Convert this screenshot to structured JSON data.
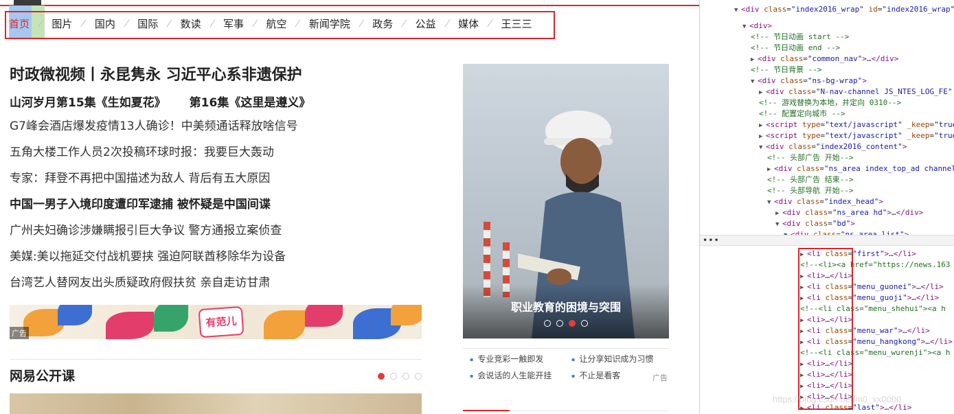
{
  "nav": {
    "items": [
      "首页",
      "图片",
      "国内",
      "国际",
      "数读",
      "军事",
      "航空",
      "新闻学院",
      "政务",
      "公益",
      "媒体",
      "王三三"
    ]
  },
  "content": {
    "headline": "时政微视频丨永昆隽永 习近平心系非遗保护",
    "subheads": [
      "山河岁月第15集《生如夏花》",
      "第16集《这里是遵义》"
    ],
    "news": [
      {
        "text": "G7峰会酒店爆发疫情13人确诊！中美频通话释放啥信号",
        "bold": false
      },
      {
        "text": "五角大楼工作人员2次投稿环球时报：我要巨大轰动",
        "bold": false
      },
      {
        "text": "专家：拜登不再把中国描述为敌人 背后有五大原因",
        "bold": false
      },
      {
        "text": "中国一男子入境印度遭印军逮捕 被怀疑是中国间谍",
        "bold": true
      },
      {
        "text": "广州夫妇确诊涉嫌瞒报引巨大争议 警方通报立案侦查",
        "bold": false
      },
      {
        "text": "美媒:美以拖延交付战机要挟 强迫阿联酋移除华为设备",
        "bold": false
      },
      {
        "text": "台湾艺人替网友出头质疑政府假扶贫 亲自走访甘肃",
        "bold": false
      }
    ],
    "ad_label": "广告",
    "ad_logo_text": "有范儿",
    "section_title": "网易公开课",
    "slide_title": "职业教育的困境与突围",
    "links": [
      "专业竞彩一触即发",
      "让分享知识成为习惯",
      "会说话的人生能开挂",
      "不止是看客"
    ],
    "links_ad": "广告"
  },
  "devtools": {
    "more": "•••",
    "watermark": "https://blog.csdn.net/m0_xx0000",
    "lines": [
      {
        "indent": 0,
        "html": "<span class='tri'>▼</span><span class='tag'>&lt;div</span> <span class='attr'>class</span>=<span class='val'>\"index2016_wrap\"</span> <span class='attr'>id</span>=<span class='val'>\"index2016_wrap\"</span><span class='tag'>&gt;</span>"
      },
      {
        "indent": 1,
        "html": "<span class='tri'>▼</span><span class='tag'>&lt;div&gt;</span>"
      },
      {
        "indent": 2,
        "html": "<span class='cmt'>&lt;!-- 节日动画 start --&gt;</span>"
      },
      {
        "indent": 2,
        "html": "<span class='cmt'>&lt;!-- 节日动画 end --&gt;</span>"
      },
      {
        "indent": 2,
        "html": "<span class='tri'>▶</span><span class='tag'>&lt;div</span> <span class='attr'>class</span>=<span class='val'>\"common_nav\"</span><span class='tag'>&gt;</span>…<span class='tag'>&lt;/div&gt;</span>"
      },
      {
        "indent": 2,
        "html": "<span class='cmt'>&lt;!-- 节日背景 --&gt;</span>"
      },
      {
        "indent": 2,
        "html": "<span class='tri'>▼</span><span class='tag'>&lt;div</span> <span class='attr'>class</span>=<span class='val'>\"ns-bg-wrap\"</span><span class='tag'>&gt;</span>"
      },
      {
        "indent": 3,
        "html": "<span class='tri'>▶</span><span class='tag'>&lt;div</span> <span class='attr'>class</span>=<span class='val'>\"N-nav-channel JS_NTES_LOG_FE\"</span>"
      },
      {
        "indent": 3,
        "html": "<span class='cmt'>&lt;!-- 游戏替换为本地，并定向 0310--&gt;</span>"
      },
      {
        "indent": 3,
        "html": "<span class='cmt'>&lt;!-- 配置定向城市 --&gt;</span>"
      },
      {
        "indent": 3,
        "html": "<span class='tri'>▶</span><span class='tag'>&lt;script</span> <span class='attr'>type</span>=<span class='val'>\"text/javascript\"</span> <span class='attr'>_keep</span>=<span class='val'>\"true\"</span>"
      },
      {
        "indent": 3,
        "html": "<span class='tri'>▶</span><span class='tag'>&lt;script</span> <span class='attr'>type</span>=<span class='val'>\"text/javascript\"</span> <span class='attr'>_keep</span>=<span class='val'>\"true\"</span>"
      },
      {
        "indent": 3,
        "html": "<span class='tri'>▼</span><span class='tag'>&lt;div</span> <span class='attr'>class</span>=<span class='val'>\"index2016_content\"</span><span class='tag'>&gt;</span>"
      },
      {
        "indent": 4,
        "html": "<span class='cmt'>&lt;!-- 头部广告 开始--&gt;</span>"
      },
      {
        "indent": 4,
        "html": "<span class='tri'>▶</span><span class='tag'>&lt;div</span> <span class='attr'>class</span>=<span class='val'>\"ns_area index_top_ad channel</span>"
      },
      {
        "indent": 4,
        "html": "<span class='cmt'>&lt;!-- 头部广告 结束--&gt;</span>"
      },
      {
        "indent": 4,
        "html": "<span class='cmt'>&lt;!-- 头部导航 开始--&gt;</span>"
      },
      {
        "indent": 4,
        "html": "<span class='tri'>▼</span><span class='tag'>&lt;div</span> <span class='attr'>class</span>=<span class='val'>\"index_head\"</span><span class='tag'>&gt;</span>"
      },
      {
        "indent": 5,
        "html": "<span class='tri'>▶</span><span class='tag'>&lt;div</span> <span class='attr'>class</span>=<span class='val'>\"ns_area hd\"</span><span class='tag'>&gt;</span>…<span class='tag'>&lt;/div&gt;</span>"
      },
      {
        "indent": 5,
        "html": "<span class='tri'>▼</span><span class='tag'>&lt;div</span> <span class='attr'>class</span>=<span class='val'>\"bd\"</span><span class='tag'>&gt;</span>"
      },
      {
        "indent": 6,
        "html": "<span class='tri'>▼</span><span class='tag'>&lt;div</span> <span class='attr'>class</span>=<span class='val'>\"ns_area list\"</span><span class='tag'>&gt;</span>"
      },
      {
        "indent": 7,
        "html": "<span class='tri'>▼</span><span class='tag'>&lt;ul&gt;</span> <span class='ele-sel'>== $0</span>"
      },
      {
        "indent": 8,
        "html": "<span class='tri'>▶</span><span class='tag'>&lt;li</span> <span class='attr'>class</span>=<span class='val'>\"first\"</span><span class='tag'>&gt;</span>…<span class='tag'>&lt;/li&gt;</span>"
      },
      {
        "indent": 8,
        "html": "<span class='cmt'>&lt;!--&lt;li&gt;&lt;a href=\"https://news.163</span>"
      },
      {
        "indent": 8,
        "html": "<span class='tri'>▶</span><span class='tag'>&lt;li&gt;</span>…<span class='tag'>&lt;/li&gt;</span>"
      },
      {
        "indent": 8,
        "html": "<span class='tri'>▶</span><span class='tag'>&lt;li</span> <span class='attr'>class</span>=<span class='val'>\"menu_guonei\"</span><span class='tag'>&gt;</span>…<span class='tag'>&lt;/li&gt;</span>"
      },
      {
        "indent": 8,
        "html": "<span class='tri'>▶</span><span class='tag'>&lt;li</span> <span class='attr'>class</span>=<span class='val'>\"menu_guoji\"</span><span class='tag'>&gt;</span>…<span class='tag'>&lt;/li&gt;</span>"
      },
      {
        "indent": 8,
        "html": "<span class='cmt'>&lt;!--&lt;li class=\"menu_shehui\"&gt;&lt;a h</span>"
      },
      {
        "indent": 8,
        "html": "<span class='tri'>▶</span><span class='tag'>&lt;li&gt;</span>…<span class='tag'>&lt;/li&gt;</span>"
      },
      {
        "indent": 8,
        "html": "<span class='tri'>▶</span><span class='tag'>&lt;li</span> <span class='attr'>class</span>=<span class='val'>\"menu_war\"</span><span class='tag'>&gt;</span>…<span class='tag'>&lt;/li&gt;</span>"
      },
      {
        "indent": 8,
        "html": "<span class='tri'>▶</span><span class='tag'>&lt;li</span> <span class='attr'>class</span>=<span class='val'>\"menu_hangkong\"</span><span class='tag'>&gt;</span>…<span class='tag'>&lt;/li&gt;</span>"
      },
      {
        "indent": 8,
        "html": "<span class='cmt'>&lt;!--&lt;li class=\"menu_wurenji\"&gt;&lt;a h</span>"
      },
      {
        "indent": 8,
        "html": "<span class='tri'>▶</span><span class='tag'>&lt;li&gt;</span>…<span class='tag'>&lt;/li&gt;</span>"
      },
      {
        "indent": 8,
        "html": "<span class='tri'>▶</span><span class='tag'>&lt;li&gt;</span>…<span class='tag'>&lt;/li&gt;</span>"
      },
      {
        "indent": 8,
        "html": "<span class='tri'>▶</span><span class='tag'>&lt;li&gt;</span>…<span class='tag'>&lt;/li&gt;</span>"
      },
      {
        "indent": 8,
        "html": "<span class='tri'>▶</span><span class='tag'>&lt;li&gt;</span>…<span class='tag'>&lt;/li&gt;</span>"
      },
      {
        "indent": 8,
        "html": "<span class='tri'>▶</span><span class='tag'>&lt;li</span> <span class='attr'>class</span>=<span class='val'>\"last\"</span><span class='tag'>&gt;</span>…<span class='tag'>&lt;/li&gt;</span>"
      }
    ]
  },
  "colors": {
    "accent": "#d9262c",
    "link_bullet": "#5a7fb5",
    "tag": "#881280",
    "attr": "#994500",
    "value": "#1a1aa6",
    "comment": "#236e25"
  }
}
